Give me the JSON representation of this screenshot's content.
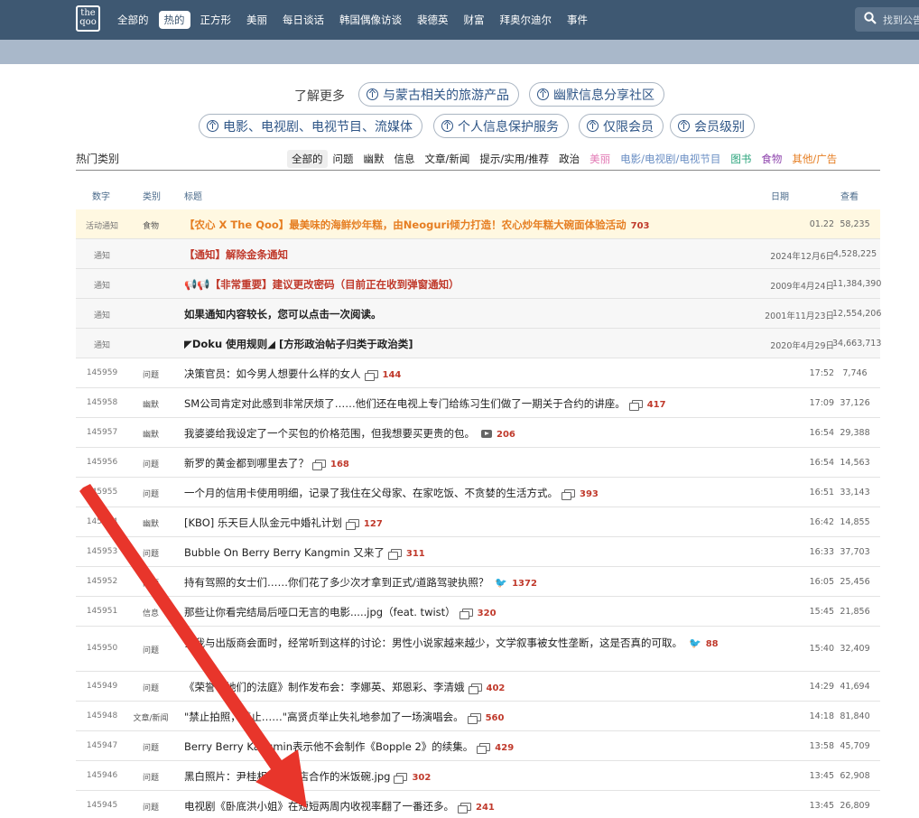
{
  "logo": "the qoo",
  "nav": [
    "全部的",
    "热的",
    "正方形",
    "美丽",
    "每日谈话",
    "韩国偶像访谈",
    "裴德英",
    "财富",
    "拜奥尔迪尔",
    "事件"
  ],
  "nav_active_index": 1,
  "search": {
    "placeholder": "找到公告"
  },
  "learn_more": {
    "label": "了解更多",
    "pills": [
      "与蒙古相关的旅游产品",
      "幽默信息分享社区",
      "电影、电视剧、电视节目、流媒体",
      "个人信息保护服务",
      "仅限会员",
      "会员级别"
    ]
  },
  "categories": {
    "title": "热门类别",
    "items": [
      {
        "label": "全部的",
        "color": "#222"
      },
      {
        "label": "问题",
        "color": "#222"
      },
      {
        "label": "幽默",
        "color": "#222"
      },
      {
        "label": "信息",
        "color": "#222"
      },
      {
        "label": "文章/新闻",
        "color": "#222"
      },
      {
        "label": "提示/实用/推荐",
        "color": "#222"
      },
      {
        "label": "政治",
        "color": "#222"
      },
      {
        "label": "美丽",
        "color": "#e27ab5"
      },
      {
        "label": "电影/电视剧/电视节目",
        "color": "#6b8fc4"
      },
      {
        "label": "图书",
        "color": "#27a37a"
      },
      {
        "label": "食物",
        "color": "#8e44ad"
      },
      {
        "label": "其他/广告",
        "color": "#e67e22"
      }
    ]
  },
  "table": {
    "headers": {
      "num": "数字",
      "cat": "类别",
      "title": "标题",
      "date": "日期",
      "views": "查看"
    },
    "rows": [
      {
        "num": "活动通知",
        "cat": "食物",
        "title": "【农心 X The Qoo】最美味的海鲜炒年糕，由Neoguri倾力打造！农心炒年糕大碗面体验活动",
        "comments": "703",
        "date": "01.22",
        "views": "58,235",
        "style": "promo"
      },
      {
        "num": "通知",
        "cat": "",
        "title": "【通知】解除金条通知",
        "comments": "",
        "date": "2024年12月6日",
        "views": "4,528,225",
        "style": "notice-red"
      },
      {
        "num": "通知",
        "cat": "",
        "title": "📢📢【非常重要】建议更改密码（目前正在收到弹窗通知）",
        "comments": "",
        "date": "2009年4月24日",
        "views": "11,384,390",
        "style": "notice-red"
      },
      {
        "num": "通知",
        "cat": "",
        "title": "如果通知内容较长，您可以点击一次阅读。",
        "comments": "",
        "date": "2001年11月23日",
        "views": "12,554,206",
        "style": "notice-bold"
      },
      {
        "num": "通知",
        "cat": "",
        "title": "◤Doku 使用规则◢ [方形政治帖子归类于政治类]",
        "comments": "",
        "date": "2020年4月29日",
        "views": "34,663,713",
        "style": "notice-bold"
      },
      {
        "num": "145959",
        "cat": "问题",
        "title": "决策官员：如今男人想要什么样的女人",
        "icon": "img",
        "comments": "144",
        "date": "17:52",
        "views": "7,746"
      },
      {
        "num": "145958",
        "cat": "幽默",
        "title": "SM公司肯定对此感到非常厌烦了……他们还在电视上专门给练习生们做了一期关于合约的讲座。",
        "icon": "img",
        "comments": "417",
        "date": "17:09",
        "views": "37,126"
      },
      {
        "num": "145957",
        "cat": "幽默",
        "title": "我婆婆给我设定了一个买包的价格范围，但我想要买更贵的包。",
        "icon": "vid",
        "comments": "206",
        "date": "16:54",
        "views": "29,388"
      },
      {
        "num": "145956",
        "cat": "问题",
        "title": "新罗的黄金都到哪里去了？",
        "icon": "img",
        "comments": "168",
        "date": "16:54",
        "views": "14,563"
      },
      {
        "num": "145955",
        "cat": "问题",
        "title": "一个月的信用卡使用明细，记录了我住在父母家、在家吃饭、不贪婪的生活方式。",
        "icon": "img",
        "comments": "393",
        "date": "16:51",
        "views": "33,143"
      },
      {
        "num": "145954",
        "cat": "幽默",
        "title": "[KBO] 乐天巨人队金元中婚礼计划",
        "icon": "img",
        "comments": "127",
        "date": "16:42",
        "views": "14,855"
      },
      {
        "num": "145953",
        "cat": "问题",
        "title": "Bubble On Berry Berry Kangmin 又来了",
        "icon": "img",
        "comments": "311",
        "date": "16:33",
        "views": "37,703"
      },
      {
        "num": "145952",
        "cat": "问题",
        "title": "持有驾照的女士们……你们花了多少次才拿到正式/道路驾驶执照？",
        "icon": "bird",
        "comments": "1372",
        "date": "16:05",
        "views": "25,456"
      },
      {
        "num": "145951",
        "cat": "信息",
        "title": "那些让你看完结局后哑口无言的电影.....jpg（feat. twist）",
        "icon": "img",
        "comments": "320",
        "date": "15:45",
        "views": "21,856"
      },
      {
        "num": "145950",
        "cat": "问题",
        "title": "当我与出版商会面时，经常听到这样的讨论：男性小说家越来越少，文学叙事被女性垄断，这是否真的可取。",
        "icon": "bird",
        "comments": "88",
        "date": "15:40",
        "views": "32,409",
        "style": "tall"
      },
      {
        "num": "145949",
        "cat": "问题",
        "title": "《荣誉：她们的法庭》制作发布会：李娜英、郑恩彩、李清娥",
        "icon": "img",
        "comments": "402",
        "date": "14:29",
        "views": "41,694"
      },
      {
        "num": "145948",
        "cat": "文章/新闻",
        "title": "\"禁止拍照，禁止……\"高贤贞举止失礼地参加了一场演唱会。",
        "icon": "img",
        "comments": "560",
        "date": "14:18",
        "views": "81,840"
      },
      {
        "num": "145947",
        "cat": "问题",
        "title": "Berry Berry Kangmin表示他不会制作《Bopple 2》的续集。",
        "icon": "img",
        "comments": "429",
        "date": "13:58",
        "views": "45,709"
      },
      {
        "num": "145946",
        "cat": "问题",
        "title": "黑白照片：尹桂相与便利店合作的米饭碗.jpg",
        "icon": "img",
        "comments": "302",
        "date": "13:45",
        "views": "62,908"
      },
      {
        "num": "145945",
        "cat": "问题",
        "title": "电视剧《卧底洪小姐》在短短两周内收视率翻了一番还多。",
        "icon": "img",
        "comments": "241",
        "date": "13:45",
        "views": "26,809"
      }
    ]
  },
  "colors": {
    "topbar": "#3e5872",
    "subbar": "#a9b8ca",
    "accent": "#2f5687",
    "comment": "#c0392b",
    "arrow": "#e8352b"
  }
}
